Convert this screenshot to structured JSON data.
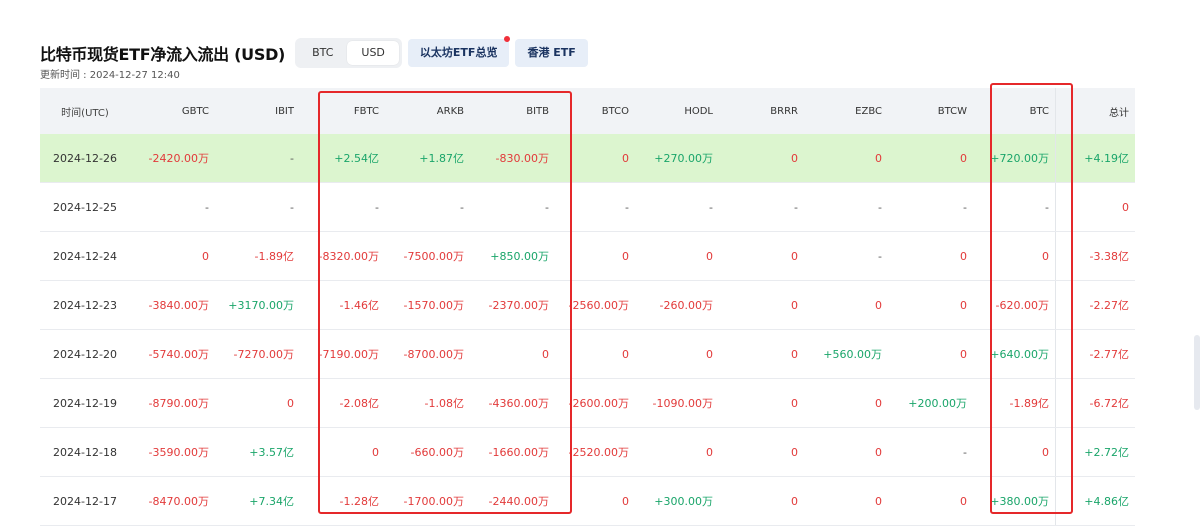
{
  "header": {
    "title": "比特币现货ETF净流入流出 (USD)",
    "toggle": [
      "BTC",
      "USD"
    ],
    "active_toggle": "USD",
    "eth_button": "以太坊ETF总览",
    "hk_button": "香港 ETF",
    "updated": "更新时间 : 2024-12-27 12:40"
  },
  "columns": [
    "时间(UTC)",
    "GBTC",
    "IBIT",
    "FBTC",
    "ARKB",
    "BITB",
    "BTCO",
    "HODL",
    "BRRR",
    "EZBC",
    "BTCW",
    "BTC",
    "总计"
  ],
  "rows": [
    {
      "date": "2024-12-26",
      "values": [
        "-2420.00万",
        "-",
        "+2.54亿",
        "+1.87亿",
        "-830.00万",
        "0",
        "+270.00万",
        "0",
        "0",
        "0",
        "+720.00万",
        "+4.19亿"
      ]
    },
    {
      "date": "2024-12-25",
      "values": [
        "-",
        "-",
        "-",
        "-",
        "-",
        "-",
        "-",
        "-",
        "-",
        "-",
        "-",
        "0"
      ]
    },
    {
      "date": "2024-12-24",
      "values": [
        "0",
        "-1.89亿",
        "-8320.00万",
        "-7500.00万",
        "+850.00万",
        "0",
        "0",
        "0",
        "-",
        "0",
        "0",
        "-3.38亿"
      ]
    },
    {
      "date": "2024-12-23",
      "values": [
        "-3840.00万",
        "+3170.00万",
        "-1.46亿",
        "-1570.00万",
        "-2370.00万",
        "-2560.00万",
        "-260.00万",
        "0",
        "0",
        "0",
        "-620.00万",
        "-2.27亿"
      ]
    },
    {
      "date": "2024-12-20",
      "values": [
        "-5740.00万",
        "-7270.00万",
        "-7190.00万",
        "-8700.00万",
        "0",
        "0",
        "0",
        "0",
        "+560.00万",
        "0",
        "+640.00万",
        "-2.77亿"
      ]
    },
    {
      "date": "2024-12-19",
      "values": [
        "-8790.00万",
        "0",
        "-2.08亿",
        "-1.08亿",
        "-4360.00万",
        "-2600.00万",
        "-1090.00万",
        "0",
        "0",
        "+200.00万",
        "-1.89亿",
        "-6.72亿"
      ]
    },
    {
      "date": "2024-12-18",
      "values": [
        "-3590.00万",
        "+3.57亿",
        "0",
        "-660.00万",
        "-1660.00万",
        "-2520.00万",
        "0",
        "0",
        "0",
        "-",
        "0",
        "+2.72亿"
      ]
    },
    {
      "date": "2024-12-17",
      "values": [
        "-8470.00万",
        "+7.34亿",
        "-1.28亿",
        "-1700.00万",
        "-2440.00万",
        "0",
        "+300.00万",
        "0",
        "0",
        "0",
        "+380.00万",
        "+4.86亿"
      ]
    }
  ],
  "colors": {
    "positive": "#1aa56a",
    "negative": "#e23a3a",
    "highlight_row": "#dcf5cf",
    "annotation_box": "#e5282a"
  }
}
